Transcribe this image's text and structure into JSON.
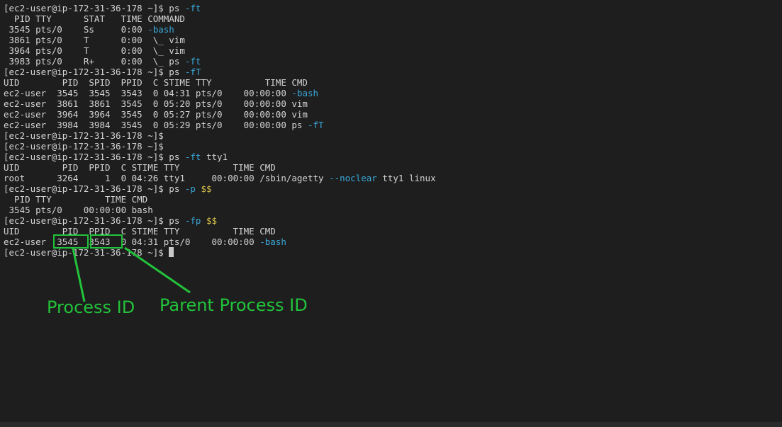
{
  "terminal": {
    "lines": [
      {
        "segments": [
          {
            "text": "[ec2-user@ip-172-31-36-178 ~]$ ps "
          },
          {
            "text": "-ft",
            "style": "flag"
          }
        ]
      },
      {
        "segments": [
          {
            "text": "  PID TTY      STAT   TIME COMMAND"
          }
        ]
      },
      {
        "segments": [
          {
            "text": " 3545 pts/0    Ss     0:00 "
          },
          {
            "text": "-bash",
            "style": "flag"
          }
        ]
      },
      {
        "segments": [
          {
            "text": " 3861 pts/0    T      0:00  \\_ vim"
          }
        ]
      },
      {
        "segments": [
          {
            "text": " 3964 pts/0    T      0:00  \\_ vim"
          }
        ]
      },
      {
        "segments": [
          {
            "text": " 3983 pts/0    R+     0:00  \\_ ps "
          },
          {
            "text": "-ft",
            "style": "flag"
          }
        ]
      },
      {
        "segments": [
          {
            "text": "[ec2-user@ip-172-31-36-178 ~]$ ps "
          },
          {
            "text": "-fT",
            "style": "flag"
          }
        ]
      },
      {
        "segments": [
          {
            "text": "UID        PID  SPID  PPID  C STIME TTY          TIME CMD"
          }
        ]
      },
      {
        "segments": [
          {
            "text": "ec2-user  3545  3545  3543  0 04:31 pts/0    00:00:00 "
          },
          {
            "text": "-bash",
            "style": "flag"
          }
        ]
      },
      {
        "segments": [
          {
            "text": "ec2-user  3861  3861  3545  0 05:20 pts/0    00:00:00 vim"
          }
        ]
      },
      {
        "segments": [
          {
            "text": "ec2-user  3964  3964  3545  0 05:27 pts/0    00:00:00 vim"
          }
        ]
      },
      {
        "segments": [
          {
            "text": "ec2-user  3984  3984  3545  0 05:29 pts/0    00:00:00 ps "
          },
          {
            "text": "-fT",
            "style": "flag"
          }
        ]
      },
      {
        "segments": [
          {
            "text": "[ec2-user@ip-172-31-36-178 ~]$"
          }
        ]
      },
      {
        "segments": [
          {
            "text": "[ec2-user@ip-172-31-36-178 ~]$"
          }
        ]
      },
      {
        "segments": [
          {
            "text": "[ec2-user@ip-172-31-36-178 ~]$ ps "
          },
          {
            "text": "-ft",
            "style": "flag"
          },
          {
            "text": " tty1"
          }
        ]
      },
      {
        "segments": [
          {
            "text": "UID        PID  PPID  C STIME TTY          TIME CMD"
          }
        ]
      },
      {
        "segments": [
          {
            "text": "root      3264     1  0 04:26 tty1     00:00:00 /sbin/agetty "
          },
          {
            "text": "--noclear",
            "style": "flag"
          },
          {
            "text": " tty1 linux"
          }
        ]
      },
      {
        "segments": [
          {
            "text": "[ec2-user@ip-172-31-36-178 ~]$ ps "
          },
          {
            "text": "-p",
            "style": "flag"
          },
          {
            "text": " "
          },
          {
            "text": "$$",
            "style": "var"
          }
        ]
      },
      {
        "segments": [
          {
            "text": "  PID TTY          TIME CMD"
          }
        ]
      },
      {
        "segments": [
          {
            "text": " 3545 pts/0    00:00:00 bash"
          }
        ]
      },
      {
        "segments": [
          {
            "text": "[ec2-user@ip-172-31-36-178 ~]$ ps "
          },
          {
            "text": "-fp",
            "style": "flag"
          },
          {
            "text": " "
          },
          {
            "text": "$$",
            "style": "var"
          }
        ]
      },
      {
        "segments": [
          {
            "text": "UID        PID  PPID  C STIME TTY          TIME CMD"
          }
        ]
      },
      {
        "segments": [
          {
            "text": "ec2-user  3545  3543  0 04:31 pts/0    00:00:00 "
          },
          {
            "text": "-bash",
            "style": "flag"
          }
        ]
      },
      {
        "segments": [
          {
            "text": "[ec2-user@ip-172-31-36-178 ~]$ "
          }
        ],
        "cursor": true
      }
    ]
  },
  "annotations": {
    "process_id_label": "Process ID",
    "parent_process_id_label": "Parent Process ID",
    "color": "#22c33a"
  },
  "colors": {
    "background": "#1e1e1e",
    "text": "#d4d4d4",
    "flag": "#3aa8d8",
    "variable": "#d7c14a"
  }
}
